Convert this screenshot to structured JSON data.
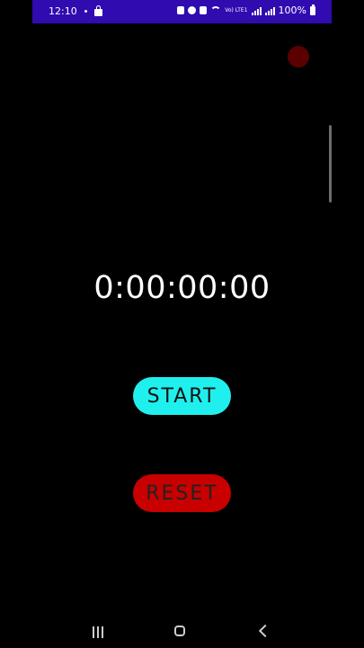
{
  "status_bar": {
    "time": "12:10",
    "battery": "100%",
    "network": "Vo) LTE1"
  },
  "timer": {
    "display": "0:00:00:00"
  },
  "buttons": {
    "start_label": "START",
    "reset_label": "RESET"
  },
  "colors": {
    "status_bar_bg": "#2f0bb0",
    "start_bg": "#1ff0ee",
    "reset_bg": "#c80000",
    "background": "#000000"
  },
  "icons": {
    "recents": "recents-icon",
    "home": "home-icon",
    "back": "back-icon"
  }
}
